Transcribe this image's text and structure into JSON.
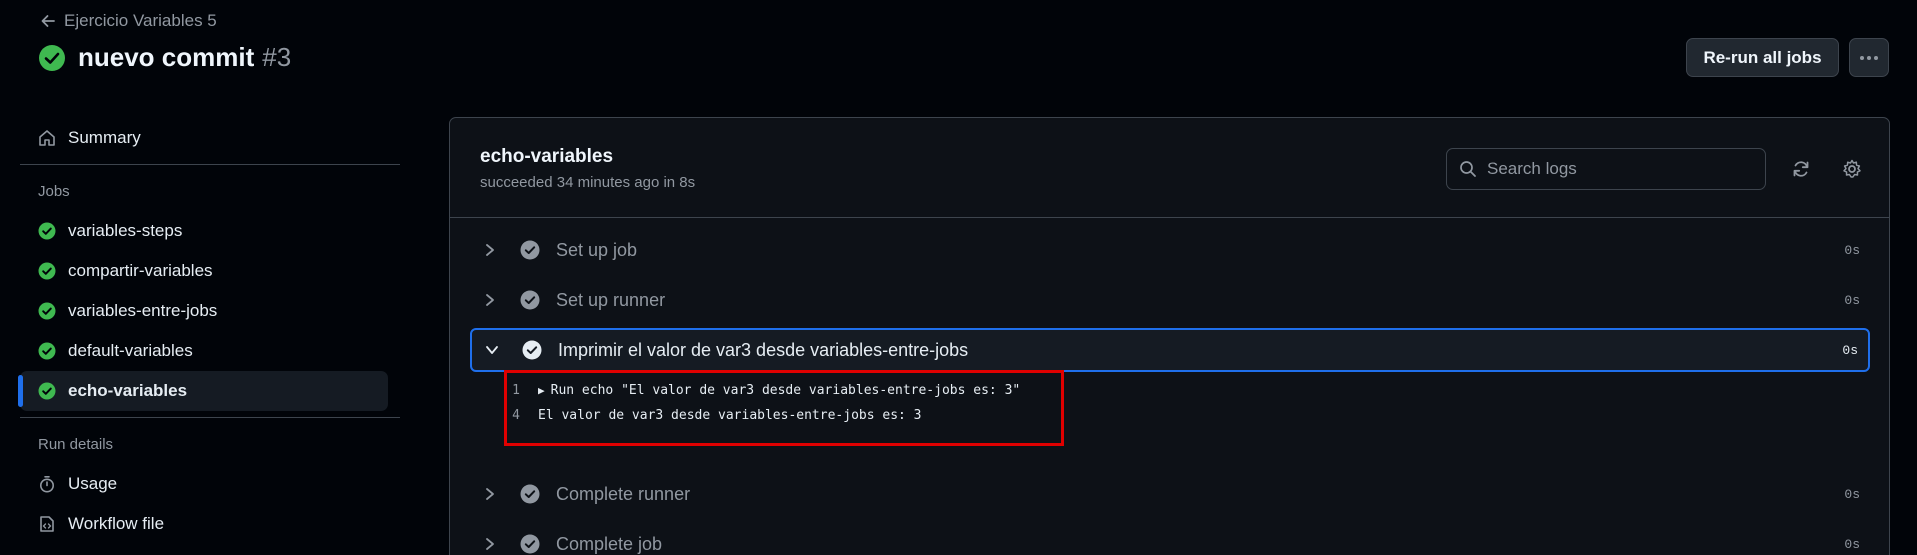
{
  "header": {
    "back_label": "Ejercicio Variables 5",
    "title": "nuevo commit",
    "run_number": "#3",
    "rerun_label": "Re-run all jobs"
  },
  "sidebar": {
    "summary_label": "Summary",
    "jobs_heading": "Jobs",
    "jobs": [
      {
        "label": "variables-steps"
      },
      {
        "label": "compartir-variables"
      },
      {
        "label": "variables-entre-jobs"
      },
      {
        "label": "default-variables"
      },
      {
        "label": "echo-variables"
      }
    ],
    "run_details_heading": "Run details",
    "usage_label": "Usage",
    "workflow_file_label": "Workflow file"
  },
  "job": {
    "name": "echo-variables",
    "meta": "succeeded 34 minutes ago in 8s",
    "search_placeholder": "Search logs"
  },
  "steps": [
    {
      "label": "Set up job",
      "duration": "0s"
    },
    {
      "label": "Set up runner",
      "duration": "0s"
    },
    {
      "label": "Imprimir el valor de var3 desde variables-entre-jobs",
      "duration": "0s"
    },
    {
      "label": "Complete runner",
      "duration": "0s"
    },
    {
      "label": "Complete job",
      "duration": "0s"
    }
  ],
  "log": [
    {
      "line": "1",
      "text": "Run echo \"El valor de var3 desde variables-entre-jobs es: 3\""
    },
    {
      "line": "4",
      "text": "El valor de var3 desde variables-entre-jobs es: 3"
    }
  ],
  "colors": {
    "success": "#3fb950",
    "accent": "#1f6feb",
    "highlight": "#e00000"
  }
}
